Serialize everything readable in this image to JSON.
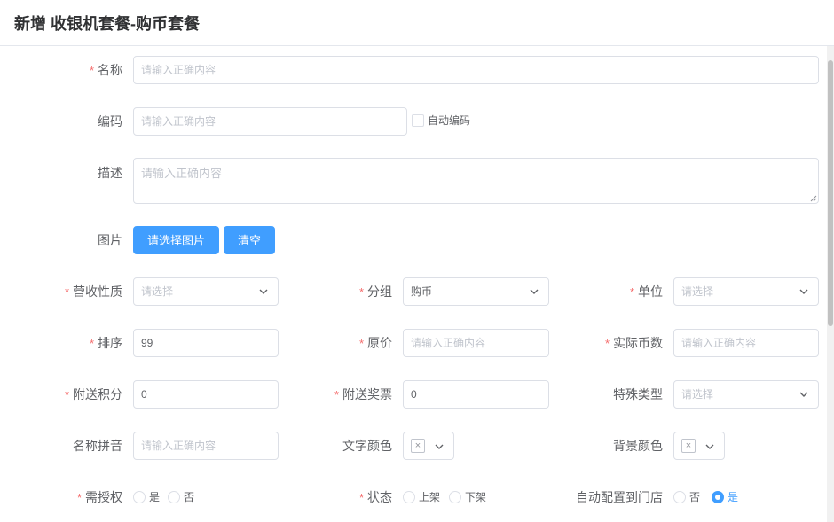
{
  "header": {
    "title": "新增 收银机套餐-购币套餐"
  },
  "form": {
    "name": {
      "label": "名称",
      "placeholder": "请输入正确内容"
    },
    "code": {
      "label": "编码",
      "placeholder": "请输入正确内容",
      "auto_label": "自动编码"
    },
    "desc": {
      "label": "描述",
      "placeholder": "请输入正确内容"
    },
    "image": {
      "label": "图片",
      "select_button": "请选择图片",
      "clear_button": "清空"
    },
    "revenue_type": {
      "label": "营收性质",
      "placeholder": "请选择"
    },
    "group": {
      "label": "分组",
      "value": "购币"
    },
    "unit": {
      "label": "单位",
      "placeholder": "请选择"
    },
    "sort": {
      "label": "排序",
      "value": "99"
    },
    "original_price": {
      "label": "原价",
      "placeholder": "请输入正确内容"
    },
    "actual_coins": {
      "label": "实际币数",
      "placeholder": "请输入正确内容"
    },
    "bonus_points": {
      "label": "附送积分",
      "value": "0"
    },
    "bonus_tickets": {
      "label": "附送奖票",
      "value": "0"
    },
    "special_type": {
      "label": "特殊类型",
      "placeholder": "请选择"
    },
    "name_pinyin": {
      "label": "名称拼音",
      "placeholder": "请输入正确内容"
    },
    "text_color": {
      "label": "文字颜色"
    },
    "bg_color": {
      "label": "背景颜色"
    },
    "need_auth": {
      "label": "需授权",
      "options": [
        "是",
        "否"
      ]
    },
    "status": {
      "label": "状态",
      "options": [
        "上架",
        "下架"
      ]
    },
    "auto_store": {
      "label": "自动配置到门店",
      "options": [
        "否",
        "是"
      ],
      "selected": "是"
    }
  },
  "colors": {
    "primary": "#409eff",
    "required": "#f56c6c",
    "border": "#dcdfe6"
  }
}
